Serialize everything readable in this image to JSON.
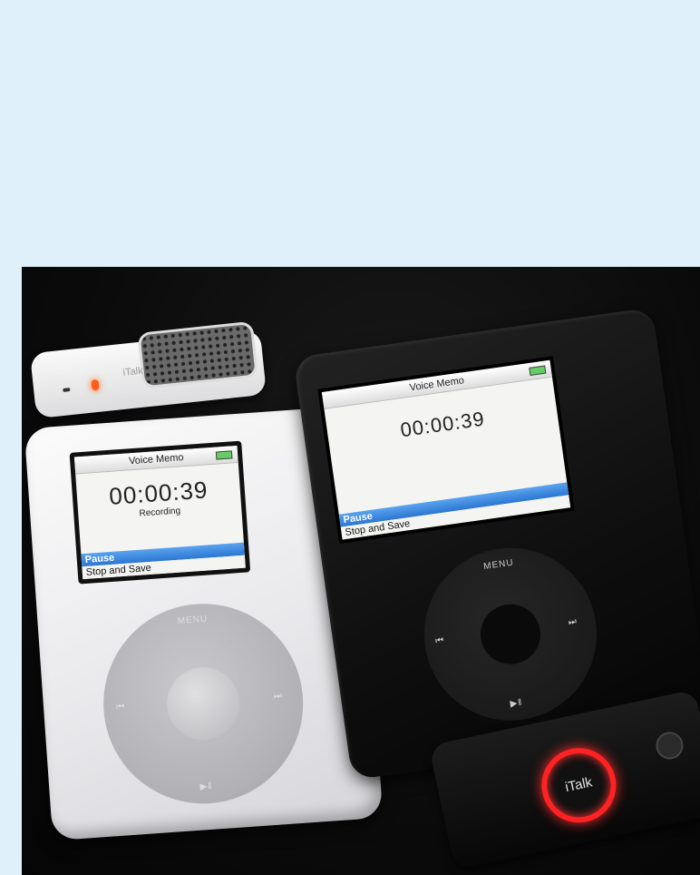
{
  "left_ipod": {
    "accessory_logo": "iTalk",
    "screen_title": "Voice Memo",
    "timer": "00:00:39",
    "status": "Recording",
    "menu": [
      "Pause",
      "Stop and Save"
    ],
    "wheel": {
      "menu": "MENU",
      "next": "⏭",
      "prev": "⏮",
      "play_pause": "▶‖"
    }
  },
  "right_ipod": {
    "screen_title": "Voice Memo",
    "timer": "00:00:39",
    "menu": [
      "Pause",
      "Stop and Save"
    ],
    "wheel": {
      "menu": "MENU",
      "next": "⏭",
      "prev": "⏮",
      "play_pause": "▶‖"
    },
    "accessory_logo": "iTalk"
  },
  "colors": {
    "background": "#e0f0fb",
    "selection_blue": "#2b76d2",
    "italk_red": "#ff2222"
  }
}
